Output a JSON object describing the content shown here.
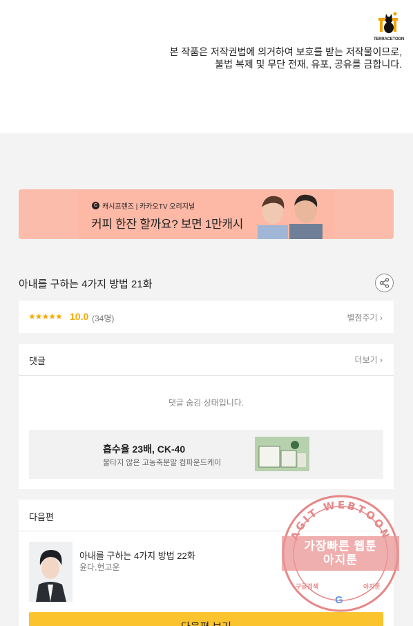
{
  "logo": {
    "text": "TERRACETOON"
  },
  "copyright_notice": {
    "line1": "본 작품은 저작권법에 의거하여 보호를 받는 저작물이므로,",
    "line2": "불법 복제 및 무단 전재, 유포, 공유를 금합니다."
  },
  "banner": {
    "subtitle_badge": "C",
    "subtitle": "캐시프렌즈 | 카카오TV 오리지널",
    "title": "커피 한잔 할까요? 보면 1만캐시"
  },
  "episode": {
    "title": "아내를 구하는 4가지 방법 21화"
  },
  "rating": {
    "stars": "★★★★★",
    "score": "10.0",
    "count": "(34명)",
    "rate_link": "별점주기"
  },
  "comments": {
    "title": "댓글",
    "more": "더보기",
    "hidden_message": "댓글 숨김 상태입니다."
  },
  "ad": {
    "title": "흡수율 23배, CK-40",
    "subtitle": "물타지 않은 고농축분말 컴파운드케이"
  },
  "next": {
    "title": "다음편",
    "episode_title": "아내를 구하는 4가지 방법 22화",
    "author": "윤다,현고운",
    "button": "다음편 보기"
  },
  "watermark": {
    "ring_text": "AGIT WEBTOON",
    "line1": "가장빠른 웹툰",
    "line2": "아지툰",
    "footer_left": "구글검색",
    "footer_right": "아지툰"
  },
  "colors": {
    "accent": "#fbc32d",
    "rating": "#f6a800",
    "banner": "#fcbcab",
    "watermark": "#e57373"
  },
  "icons": [
    "terrace-cat-logo-icon",
    "share-icon",
    "chevron-right-icon",
    "google-icon"
  ]
}
